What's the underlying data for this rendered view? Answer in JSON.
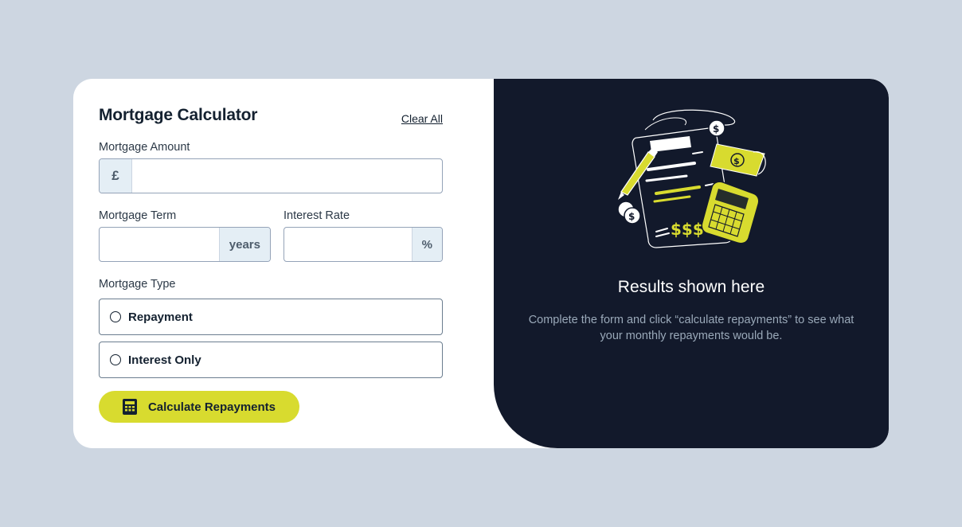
{
  "form": {
    "title": "Mortgage Calculator",
    "clear_label": "Clear All",
    "amount": {
      "label": "Mortgage Amount",
      "prefix": "£",
      "value": ""
    },
    "term": {
      "label": "Mortgage Term",
      "suffix": "years",
      "value": ""
    },
    "rate": {
      "label": "Interest Rate",
      "suffix": "%",
      "value": ""
    },
    "type": {
      "label": "Mortgage Type",
      "options": [
        {
          "label": "Repayment",
          "selected": false
        },
        {
          "label": "Interest Only",
          "selected": false
        }
      ]
    },
    "submit_label": "Calculate Repayments",
    "submit_icon": "calculator-icon"
  },
  "results": {
    "title": "Results shown here",
    "description": "Complete the form and click “calculate repayments” to see what your monthly repayments would be.",
    "illustration": "empty-results-illustration"
  },
  "colors": {
    "background": "#cdd6e1",
    "accent": "#d8db2f",
    "dark_panel": "#12192b",
    "text": "#142130"
  }
}
